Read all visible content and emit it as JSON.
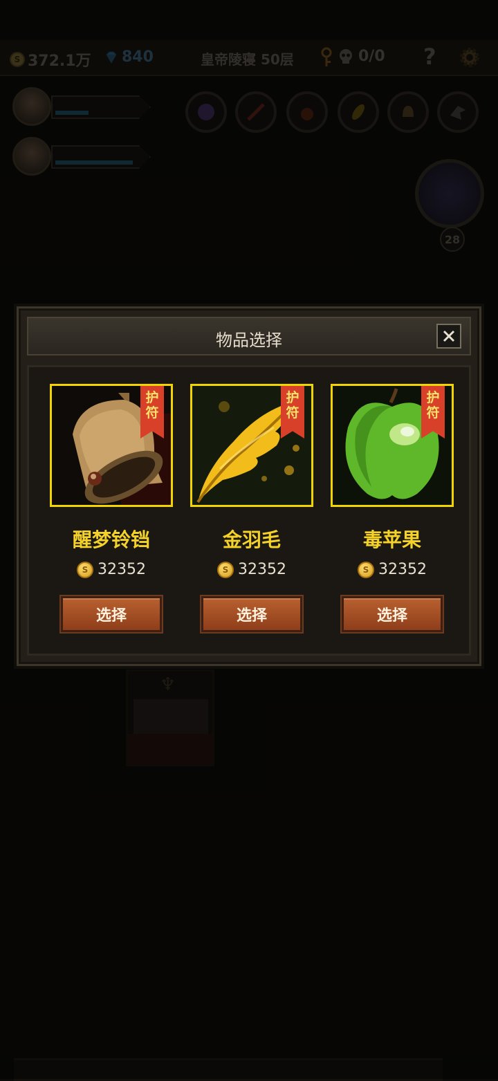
{
  "topbar": {
    "gold": "372.1万",
    "gems": "840",
    "floor": "皇帝陵寝 50层",
    "kills": "0/0",
    "help": "?"
  },
  "fairy": {
    "level": "28"
  },
  "modal": {
    "title": "物品选择",
    "close": "×",
    "items": [
      {
        "name": "醒梦铃铛",
        "tag_line1": "护",
        "tag_line2": "符",
        "price": "32352",
        "button": "选择",
        "icon": "bell-icon"
      },
      {
        "name": "金羽毛",
        "tag_line1": "护",
        "tag_line2": "符",
        "price": "32352",
        "button": "选择",
        "icon": "golden-feather-icon"
      },
      {
        "name": "毒苹果",
        "tag_line1": "护",
        "tag_line2": "符",
        "price": "32352",
        "button": "选择",
        "icon": "green-apple-icon"
      }
    ]
  },
  "colors": {
    "frame_yellow": "#f2d500",
    "name_yellow": "#f4d22a",
    "tag_red": "#d8402a",
    "button_orange": "#b8602f"
  }
}
